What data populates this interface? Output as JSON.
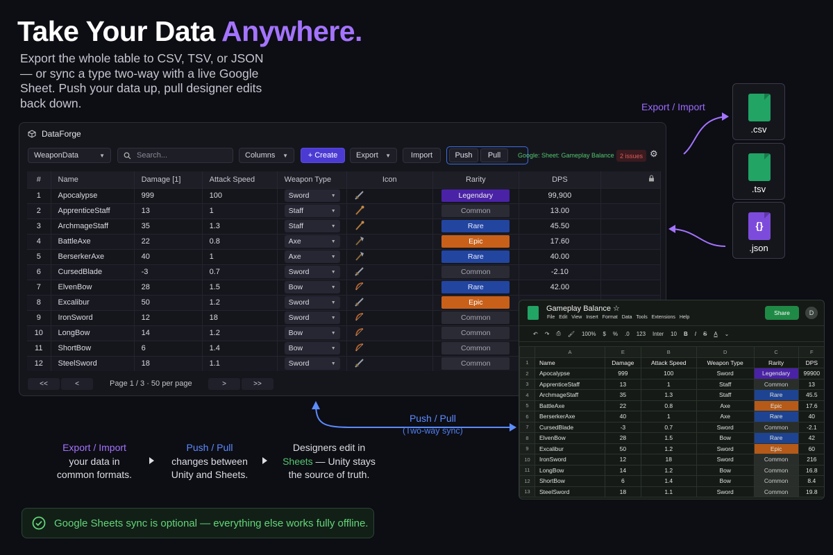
{
  "headline": {
    "main": "Take Your Data ",
    "accent": "Anywhere."
  },
  "subtext": "Export the whole table to CSV, TSV, or JSON — or sync a type two-way with a live Google Sheet. Push your data up, pull designer edits back down.",
  "colors": {
    "accent_purple": "#a474ff",
    "push_blue": "#5c8dff",
    "sheets_green": "#21a464",
    "create_button": "#4b3bd3"
  },
  "app": {
    "title": "DataForge",
    "type_select": "WeaponData",
    "search_placeholder": "Search...",
    "columns_label": "Columns",
    "create_label": "+ Create",
    "export_label": "Export",
    "import_label": "Import",
    "push_label": "Push",
    "pull_label": "Pull",
    "sheet_link": "Google: Sheet: Gameplay Balance",
    "issues": "2 issues",
    "columns": [
      "#",
      "Name",
      "Damage [1]",
      "Attack Speed",
      "Weapon Type",
      "Icon",
      "Rarity",
      "DPS"
    ],
    "rows": [
      {
        "n": "1",
        "name": "Apocalypse",
        "damage": "999",
        "speed": "100",
        "type": "Sword",
        "icon": "sword-icon",
        "rarity": "Legendary",
        "dps": "99,900"
      },
      {
        "n": "2",
        "name": "ApprenticeStaff",
        "damage": "13",
        "speed": "1",
        "type": "Staff",
        "icon": "staff-icon",
        "rarity": "Common",
        "dps": "13.00"
      },
      {
        "n": "3",
        "name": "ArchmageStaff",
        "damage": "35",
        "speed": "1.3",
        "type": "Staff",
        "icon": "staff-icon",
        "rarity": "Rare",
        "dps": "45.50"
      },
      {
        "n": "4",
        "name": "BattleAxe",
        "damage": "22",
        "speed": "0.8",
        "type": "Axe",
        "icon": "axe-icon",
        "rarity": "Epic",
        "dps": "17.60"
      },
      {
        "n": "5",
        "name": "BerserkerAxe",
        "damage": "40",
        "speed": "1",
        "type": "Axe",
        "icon": "axe-icon",
        "rarity": "Rare",
        "dps": "40.00"
      },
      {
        "n": "6",
        "name": "CursedBlade",
        "damage": "-3",
        "speed": "0.7",
        "type": "Sword",
        "icon": "sword-icon",
        "rarity": "Common",
        "dps": "-2.10"
      },
      {
        "n": "7",
        "name": "ElvenBow",
        "damage": "28",
        "speed": "1.5",
        "type": "Bow",
        "icon": "bow-icon",
        "rarity": "Rare",
        "dps": "42.00"
      },
      {
        "n": "8",
        "name": "Excalibur",
        "damage": "50",
        "speed": "1.2",
        "type": "Sword",
        "icon": "sword-icon",
        "rarity": "Epic",
        "dps": ""
      },
      {
        "n": "9",
        "name": "IronSword",
        "damage": "12",
        "speed": "18",
        "type": "Sword",
        "icon": "bow-icon",
        "rarity": "Common",
        "dps": ""
      },
      {
        "n": "10",
        "name": "LongBow",
        "damage": "14",
        "speed": "1.2",
        "type": "Bow",
        "icon": "bow-icon",
        "rarity": "Common",
        "dps": ""
      },
      {
        "n": "11",
        "name": "ShortBow",
        "damage": "6",
        "speed": "1.4",
        "type": "Bow",
        "icon": "bow-icon",
        "rarity": "Common",
        "dps": ""
      },
      {
        "n": "12",
        "name": "SteelSword",
        "damage": "18",
        "speed": "1.1",
        "type": "Sword",
        "icon": "sword-icon",
        "rarity": "Common",
        "dps": ""
      }
    ],
    "pager": {
      "first": "<<",
      "prev": "<",
      "info": "Page 1 / 3  ·  50 per page",
      "next": ">",
      "last": ">>"
    }
  },
  "export_import_label": "Export / Import",
  "files": [
    ".csv",
    ".tsv",
    ".json"
  ],
  "sheet": {
    "title": "Gameplay Balance",
    "menu": "File Edit View Insert Format Data Tools Extensions Help",
    "share": "Share",
    "avatar": "D",
    "zoom": "100%",
    "font": "Inter",
    "font_size": "10",
    "col_letters": [
      "A",
      "E",
      "B",
      "D",
      "C",
      "F"
    ],
    "header": [
      "Name",
      "Damage",
      "Attack Speed",
      "Weapon Type",
      "Rarity",
      "DPS"
    ],
    "rows": [
      [
        "Apocalypse",
        "999",
        "100",
        "Sword",
        "Legendary",
        "99900"
      ],
      [
        "ApprenticeStaff",
        "13",
        "1",
        "Staff",
        "Common",
        "13"
      ],
      [
        "ArchmageStaff",
        "35",
        "1.3",
        "Staff",
        "Rare",
        "45.5"
      ],
      [
        "BattleAxe",
        "22",
        "0.8",
        "Axe",
        "Epic",
        "17.6"
      ],
      [
        "BerserkerAxe",
        "40",
        "1",
        "Axe",
        "Rare",
        "40"
      ],
      [
        "CursedBlade",
        "-3",
        "0.7",
        "Sword",
        "Common",
        "-2.1"
      ],
      [
        "ElvenBow",
        "28",
        "1.5",
        "Bow",
        "Rare",
        "42"
      ],
      [
        "Excalibur",
        "50",
        "1.2",
        "Sword",
        "Epic",
        "60"
      ],
      [
        "IronSword",
        "12",
        "18",
        "Sword",
        "Common",
        "216"
      ],
      [
        "LongBow",
        "14",
        "1.2",
        "Bow",
        "Common",
        "16.8"
      ],
      [
        "ShortBow",
        "6",
        "1.4",
        "Bow",
        "Common",
        "8.4"
      ],
      [
        "SteelSword",
        "18",
        "1.1",
        "Sword",
        "Common",
        "19.8"
      ]
    ]
  },
  "push_pull": {
    "title": "Push / Pull",
    "sub": "(Two-way sync)"
  },
  "steps": [
    {
      "hl": "Export / Import",
      "hl_color": "#a474ff",
      "text": "your data in common formats."
    },
    {
      "hl": "Push / Pull",
      "hl_color": "#5c8dff",
      "text": "changes between Unity and Sheets."
    },
    {
      "pre": "Designers edit in",
      "hl": "Sheets",
      "hl_color": "#53c66e",
      "text": " — Unity stays the source of truth."
    }
  ],
  "note": "Google Sheets sync is optional — everything else works fully offline."
}
